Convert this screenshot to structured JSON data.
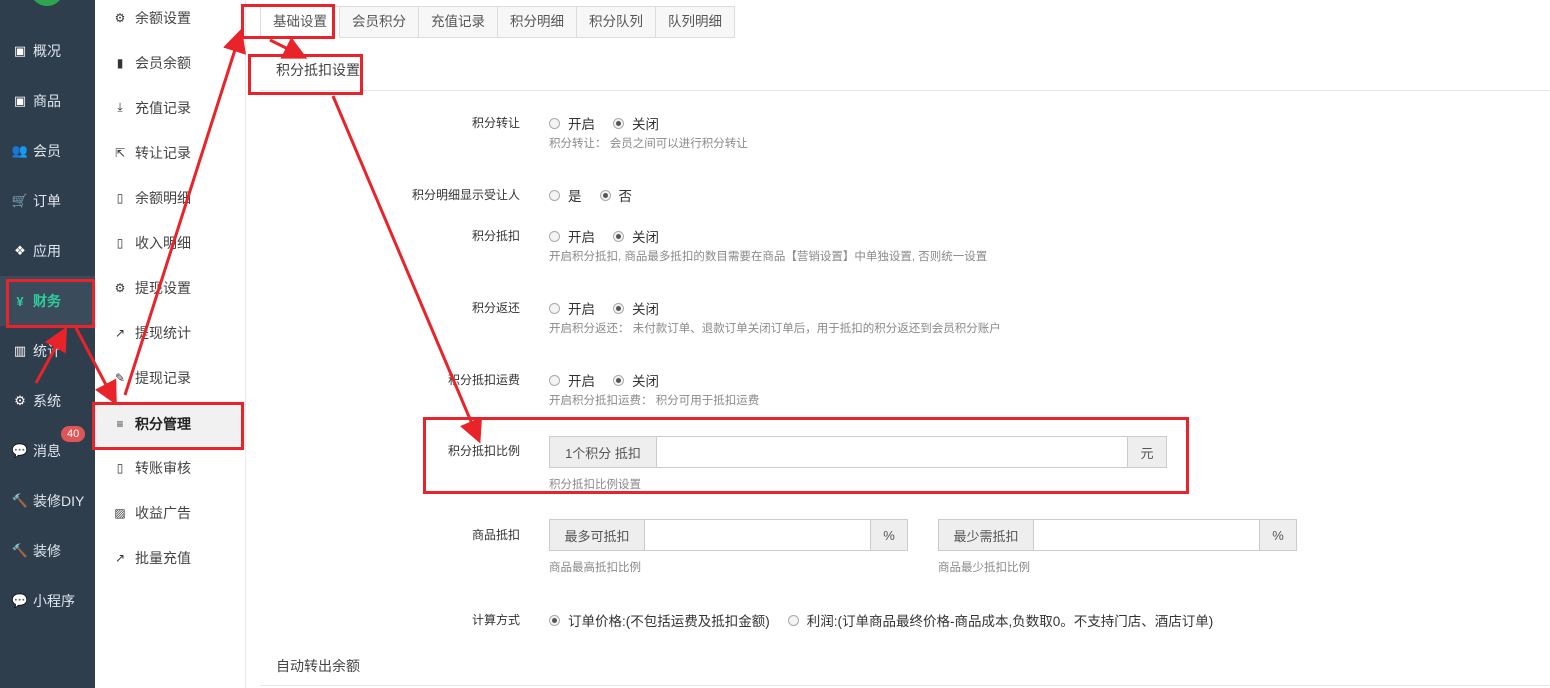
{
  "main_nav": {
    "items": [
      {
        "label": "概况",
        "icon": "archive-icon",
        "glyph": "▣"
      },
      {
        "label": "商品",
        "icon": "archive-icon",
        "glyph": "▣"
      },
      {
        "label": "会员",
        "icon": "users-icon",
        "glyph": "👥"
      },
      {
        "label": "订单",
        "icon": "cart-icon",
        "glyph": "🛒"
      },
      {
        "label": "应用",
        "icon": "cubes-icon",
        "glyph": "❖"
      },
      {
        "label": "财务",
        "icon": "yen-icon",
        "glyph": "¥"
      },
      {
        "label": "统计",
        "icon": "bar-chart-icon",
        "glyph": "▥"
      },
      {
        "label": "系统",
        "icon": "gears-icon",
        "glyph": "⚙"
      },
      {
        "label": "消息",
        "icon": "comment-icon",
        "glyph": "💬"
      },
      {
        "label": "装修DIY",
        "icon": "gavel-icon",
        "glyph": "🔨"
      },
      {
        "label": "装修",
        "icon": "gavel-icon",
        "glyph": "🔨"
      },
      {
        "label": "小程序",
        "icon": "wechat-icon",
        "glyph": "💬"
      }
    ],
    "active": "财务",
    "message_badge": "40"
  },
  "sub_nav": {
    "items": [
      {
        "label": "余额设置",
        "icon": "gear-icon",
        "glyph": "⚙"
      },
      {
        "label": "会员余额",
        "icon": "book-icon",
        "glyph": "▮"
      },
      {
        "label": "充值记录",
        "icon": "download-icon",
        "glyph": "⤓"
      },
      {
        "label": "转让记录",
        "icon": "external-link-icon",
        "glyph": "⇱"
      },
      {
        "label": "余额明细",
        "icon": "file-icon",
        "glyph": "▯"
      },
      {
        "label": "收入明细",
        "icon": "file-icon",
        "glyph": "▯"
      },
      {
        "label": "提现设置",
        "icon": "gear-icon",
        "glyph": "⚙"
      },
      {
        "label": "提现统计",
        "icon": "line-chart-icon",
        "glyph": "↗"
      },
      {
        "label": "提现记录",
        "icon": "pencil-icon",
        "glyph": "✎"
      },
      {
        "label": "积分管理",
        "icon": "database-icon",
        "glyph": "≡"
      },
      {
        "label": "转账审核",
        "icon": "file-icon",
        "glyph": "▯"
      },
      {
        "label": "收益广告",
        "icon": "image-icon",
        "glyph": "▨"
      },
      {
        "label": "批量充值",
        "icon": "line-chart-icon",
        "glyph": "↗"
      }
    ],
    "active": "积分管理"
  },
  "tabs": [
    "基础设置",
    "会员积分",
    "充值记录",
    "积分明细",
    "积分队列",
    "队列明细"
  ],
  "section_title": "积分抵扣设置",
  "form": {
    "transfer": {
      "label": "积分转让",
      "options": [
        "开启",
        "关闭"
      ],
      "selected": "关闭",
      "help": "积分转让： 会员之间可以进行积分转让"
    },
    "show_receiver": {
      "label": "积分明细显示受让人",
      "options": [
        "是",
        "否"
      ],
      "selected": "否"
    },
    "deduct": {
      "label": "积分抵扣",
      "options": [
        "开启",
        "关闭"
      ],
      "selected": "关闭",
      "help": "开启积分抵扣, 商品最多抵扣的数目需要在商品【营销设置】中单独设置, 否则统一设置"
    },
    "refund": {
      "label": "积分返还",
      "options": [
        "开启",
        "关闭"
      ],
      "selected": "关闭",
      "help": "开启积分返还： 未付款订单、退款订单关闭订单后，用于抵扣的积分返还到会员积分账户"
    },
    "shipping": {
      "label": "积分抵扣运费",
      "options": [
        "开启",
        "关闭"
      ],
      "selected": "关闭",
      "help": "开启积分抵扣运费： 积分可用于抵扣运费"
    },
    "ratio": {
      "label": "积分抵扣比例",
      "prefix": "1个积分 抵扣",
      "value": "",
      "suffix": "元",
      "help": "积分抵扣比例设置"
    },
    "goods_deduct": {
      "label": "商品抵扣",
      "max_prefix": "最多可抵扣",
      "max_value": "",
      "max_suffix": "%",
      "max_help": "商品最高抵扣比例",
      "min_prefix": "最少需抵扣",
      "min_value": "",
      "min_suffix": "%",
      "min_help": "商品最少抵扣比例"
    },
    "calc": {
      "label": "计算方式",
      "options": [
        "订单价格:(不包括运费及抵扣金额)",
        "利润:(订单商品最终价格-商品成本,负数取0。不支持门店、酒店订单)"
      ],
      "selected": "订单价格:(不包括运费及抵扣金额)"
    }
  },
  "next_section_title": "自动转出余额",
  "colors": {
    "nav_bg": "#2f3e4d",
    "active_green": "#2ecc9a",
    "annotation_red": "#e8232a",
    "badge_red": "#e05656"
  }
}
